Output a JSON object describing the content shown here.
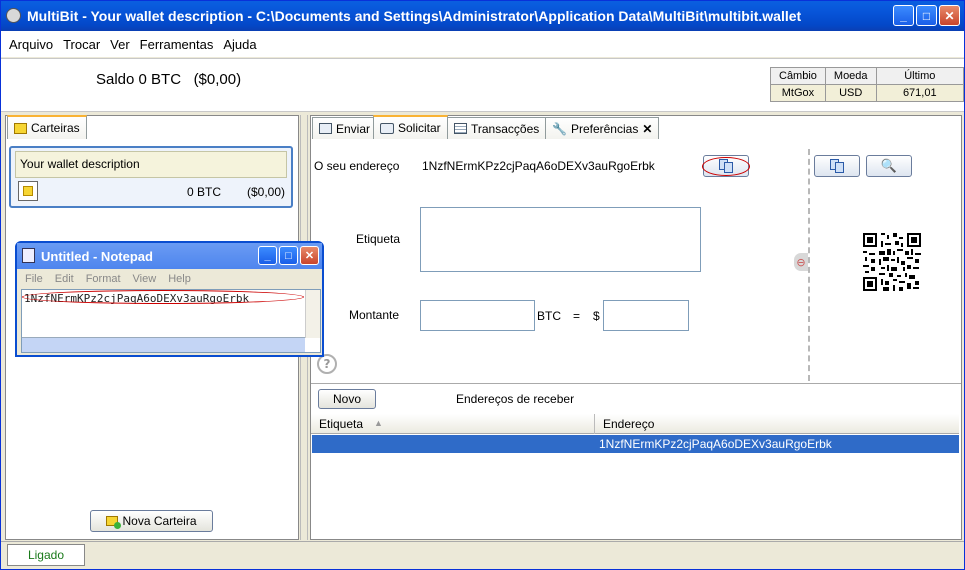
{
  "window": {
    "title": "MultiBit - Your wallet description - C:\\Documents and Settings\\Administrator\\Application Data\\MultiBit\\multibit.wallet",
    "minimize_icon": "minimize-icon",
    "maximize_icon": "maximize-icon",
    "close_icon": "close-icon"
  },
  "menu": [
    "Arquivo",
    "Trocar",
    "Ver",
    "Ferramentas",
    "Ajuda"
  ],
  "header": {
    "balance": "Saldo 0 BTC",
    "balance_fiat": "($0,00)",
    "ticker": {
      "headers": [
        "Câmbio",
        "Moeda",
        "Último"
      ],
      "row": [
        "MtGox",
        "USD",
        "671,01"
      ]
    }
  },
  "wallets_panel": {
    "tab_label": "Carteiras",
    "wallet": {
      "description": "Your wallet description",
      "balance": "0 BTC",
      "balance_fiat": "($0,00)"
    },
    "new_wallet_button": "Nova Carteira"
  },
  "tabs": [
    {
      "label": "Enviar",
      "icon": "send-icon"
    },
    {
      "label": "Solicitar",
      "icon": "request-icon",
      "selected": true
    },
    {
      "label": "Transacções",
      "icon": "transactions-icon"
    },
    {
      "label": "Preferências",
      "icon": "preferences-icon"
    }
  ],
  "request": {
    "address_label": "O seu endereço",
    "address": "1NzfNErmKPz2cjPaqA6oDEXv3auRgoErbk",
    "label_label": "Etiqueta",
    "label_value": "",
    "amount_label": "Montante",
    "amount_btc": "",
    "btc_unit": "BTC",
    "equals": "=",
    "currency_symbol": "$",
    "amount_fiat": ""
  },
  "address_list": {
    "new_button": "Novo",
    "title": "Endereços de receber",
    "columns": [
      "Etiqueta",
      "Endereço"
    ],
    "rows": [
      {
        "label": "",
        "address": "1NzfNErmKPz2cjPaqA6oDEXv3auRgoErbk"
      }
    ]
  },
  "notepad": {
    "title": "Untitled - Notepad",
    "menu": [
      "File",
      "Edit",
      "Format",
      "View",
      "Help"
    ],
    "content": "1NzfNErmKPz2cjPaqA6oDEXv3auRgoErbk"
  },
  "status": {
    "text": "Ligado",
    "color": "#1a7a1a"
  },
  "colors": {
    "titlebar": "#0754d8",
    "selection": "#2f6bc8",
    "annotation": "#cc0000"
  }
}
